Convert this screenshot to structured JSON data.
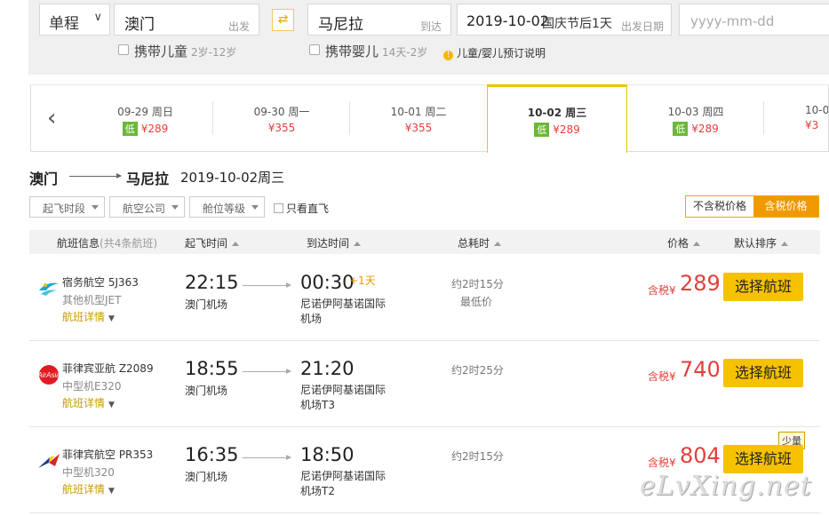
{
  "search": {
    "trip_type": "单程",
    "from_city": "澳门",
    "from_tag": "出发",
    "to_city": "马尼拉",
    "to_tag": "到达",
    "depart_date": "2019-10-02",
    "holiday_note": "国庆节后1天",
    "date_tag": "出发日期",
    "return_placeholder": "yyyy-mm-dd",
    "child_label": "携带儿童",
    "child_age": "2岁-12岁",
    "infant_label": "携带婴儿",
    "infant_age": "14天-2岁",
    "booking_note": "儿童/婴儿预订说明"
  },
  "date_tabs": [
    {
      "date": "09-29 周日",
      "low": "低",
      "price": "¥289"
    },
    {
      "date": "09-30 周一",
      "low": "",
      "price": "¥355"
    },
    {
      "date": "10-01 周二",
      "low": "",
      "price": "¥355"
    },
    {
      "date": "10-02 周三",
      "low": "低",
      "price": "¥289",
      "active": true
    },
    {
      "date": "10-03 周四",
      "low": "低",
      "price": "¥289"
    },
    {
      "date": "10-0",
      "low": "",
      "price": "¥3"
    }
  ],
  "route": {
    "from": "澳门",
    "to": "马尼拉",
    "date": "2019-10-02周三"
  },
  "filters": {
    "time": "起飞时段",
    "airline": "航空公司",
    "cabin": "舱位等级",
    "direct": "只看直飞",
    "price_excl_tax": "不含税价格",
    "price_incl_tax": "含税价格"
  },
  "table_header": {
    "flight_info": "航班信息",
    "count": "(共4条航班)",
    "depart": "起飞时间",
    "arrive": "到达时间",
    "duration": "总耗时",
    "price": "价格",
    "sort": "默认排序"
  },
  "flights": [
    {
      "airline": "宿务航空 5J363",
      "model": "其他机型JET",
      "detail": "航班详情",
      "dep_time": "22:15",
      "dep_airport": "澳门机场",
      "arr_time": "00:30",
      "next_day": "+1天",
      "arr_airport": "尼诺伊阿基诺国际机场",
      "duration": "约2时15分",
      "duration_note": "最低价",
      "tax_label": "含税¥",
      "price": "289",
      "button": "选择航班",
      "badge": ""
    },
    {
      "airline": "菲律宾亚航 Z2089",
      "model": "中型机E320",
      "detail": "航班详情",
      "dep_time": "18:55",
      "dep_airport": "澳门机场",
      "arr_time": "21:20",
      "next_day": "",
      "arr_airport": "尼诺伊阿基诺国际机场T3",
      "duration": "约2时25分",
      "duration_note": "",
      "tax_label": "含税¥",
      "price": "740",
      "button": "选择航班",
      "badge": ""
    },
    {
      "airline": "菲律宾航空 PR353",
      "model": "中型机320",
      "detail": "航班详情",
      "dep_time": "16:35",
      "dep_airport": "澳门机场",
      "arr_time": "18:50",
      "next_day": "",
      "arr_airport": "尼诺伊阿基诺国际机场T2",
      "duration": "约2时15分",
      "duration_note": "",
      "tax_label": "含税¥",
      "price": "804",
      "button": "选择航班",
      "badge": "少量"
    }
  ],
  "watermark": "eLvXing.net",
  "colors": {
    "accent": "#f6c200",
    "price": "#e2403a",
    "low_badge": "#6bb838",
    "toggle_active": "#f09900"
  }
}
